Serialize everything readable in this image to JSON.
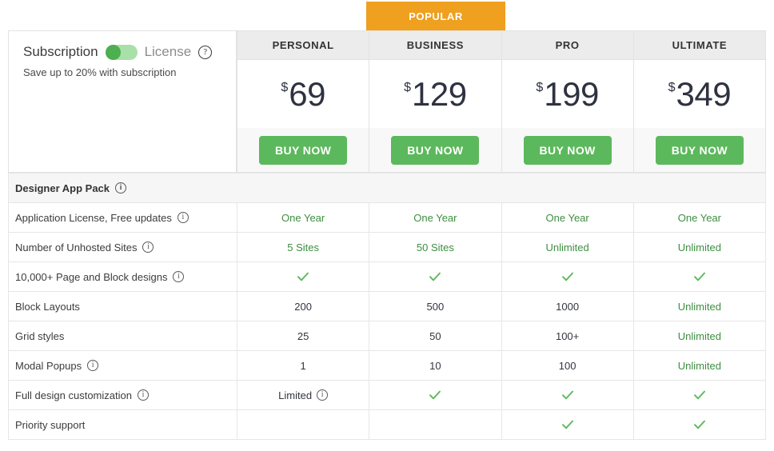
{
  "banner": {
    "label": "POPULAR",
    "color": "#EFA01F",
    "over_plan": "BUSINESS"
  },
  "promo": {
    "toggle_left_label": "Subscription",
    "toggle_right_label": "License",
    "help_icon": "question-circle-icon",
    "toggle_state": "subscription",
    "subtext": "Save up to 20% with subscription",
    "accent_color": "#4CAF50"
  },
  "plans": [
    {
      "name": "PERSONAL",
      "currency": "$",
      "price": "69",
      "buy_label": "BUY NOW",
      "popular": false
    },
    {
      "name": "BUSINESS",
      "currency": "$",
      "price": "129",
      "buy_label": "BUY NOW",
      "popular": true
    },
    {
      "name": "PRO",
      "currency": "$",
      "price": "199",
      "buy_label": "BUY NOW",
      "popular": false
    },
    {
      "name": "ULTIMATE",
      "currency": "$",
      "price": "349",
      "buy_label": "BUY NOW",
      "popular": false
    }
  ],
  "section": {
    "title": "Designer App Pack",
    "info_icon": "info-circle-icon"
  },
  "features": [
    {
      "label": "Application License, Free updates",
      "info": true,
      "cells": [
        {
          "text": "One Year",
          "style": "green"
        },
        {
          "text": "One Year",
          "style": "green"
        },
        {
          "text": "One Year",
          "style": "green"
        },
        {
          "text": "One Year",
          "style": "green"
        }
      ]
    },
    {
      "label": "Number of Unhosted Sites",
      "info": true,
      "cells": [
        {
          "text": "5 Sites",
          "style": "green"
        },
        {
          "text": "50 Sites",
          "style": "green"
        },
        {
          "text": "Unlimited",
          "style": "green"
        },
        {
          "text": "Unlimited",
          "style": "green"
        }
      ]
    },
    {
      "label": "10,000+ Page and Block designs",
      "info": true,
      "cells": [
        {
          "check": true
        },
        {
          "check": true
        },
        {
          "check": true
        },
        {
          "check": true
        }
      ]
    },
    {
      "label": "Block Layouts",
      "info": false,
      "cells": [
        {
          "text": "200",
          "style": "plain"
        },
        {
          "text": "500",
          "style": "plain"
        },
        {
          "text": "1000",
          "style": "plain"
        },
        {
          "text": "Unlimited",
          "style": "green"
        }
      ]
    },
    {
      "label": "Grid styles",
      "info": false,
      "cells": [
        {
          "text": "25",
          "style": "plain"
        },
        {
          "text": "50",
          "style": "plain"
        },
        {
          "text": "100+",
          "style": "plain"
        },
        {
          "text": "Unlimited",
          "style": "green"
        }
      ]
    },
    {
      "label": "Modal Popups",
      "info": true,
      "cells": [
        {
          "text": "1",
          "style": "plain"
        },
        {
          "text": "10",
          "style": "plain"
        },
        {
          "text": "100",
          "style": "plain"
        },
        {
          "text": "Unlimited",
          "style": "green"
        }
      ]
    },
    {
      "label": "Full design customization",
      "info": true,
      "cells": [
        {
          "text": "Limited",
          "style": "plain",
          "info": true
        },
        {
          "check": true
        },
        {
          "check": true
        },
        {
          "check": true
        }
      ]
    },
    {
      "label": "Priority support",
      "info": false,
      "cells": [
        {
          "text": "",
          "style": "plain"
        },
        {
          "text": "",
          "style": "plain"
        },
        {
          "check": true
        },
        {
          "check": true
        }
      ]
    }
  ],
  "colors": {
    "buy_button": "#5CB85C",
    "check": "#5CB85C",
    "green_text": "#3e8e41",
    "banner": "#EFA01F",
    "price_text": "#2e3240"
  }
}
